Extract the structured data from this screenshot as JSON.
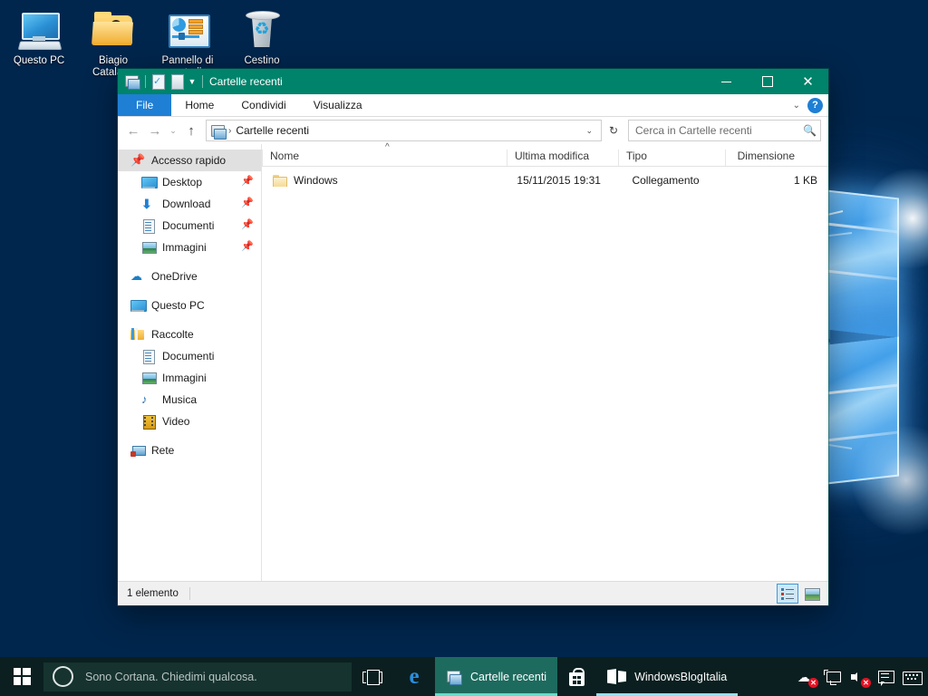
{
  "desktop": {
    "icons": [
      {
        "name": "Questo PC",
        "icon": "computer-icon"
      },
      {
        "name": "Biagio Catalano",
        "icon": "user-folder-icon"
      },
      {
        "name": "Pannello di controllo",
        "icon": "control-panel-icon"
      },
      {
        "name": "Cestino",
        "icon": "recycle-bin-icon"
      }
    ]
  },
  "explorer": {
    "title": "Cartelle recenti",
    "quick_access_toolbar": [
      {
        "icon": "explorer-icon",
        "name": "folder-properties"
      },
      {
        "icon": "properties-icon",
        "name": "properties"
      },
      {
        "icon": "new-folder-icon",
        "name": "new-folder"
      },
      {
        "icon": "chevron-down-icon",
        "name": "customize-qat"
      }
    ],
    "window_controls": {
      "minimize": "minimize-icon",
      "maximize": "maximize-icon",
      "close": "close-icon"
    },
    "ribbon": {
      "tabs": [
        {
          "label": "File",
          "active": true
        },
        {
          "label": "Home",
          "active": false
        },
        {
          "label": "Condividi",
          "active": false
        },
        {
          "label": "Visualizza",
          "active": false
        }
      ],
      "collapse_icon": "chevron-down-icon",
      "help_label": "?"
    },
    "addressbar": {
      "back_icon": "arrow-left-icon",
      "forward_icon": "arrow-right-icon",
      "recent_icon": "chevron-down-icon",
      "up_icon": "arrow-up-icon",
      "crumb": "Cartelle recenti",
      "separator": "›",
      "dropdown_icon": "chevron-down-icon",
      "refresh_icon": "↻"
    },
    "search": {
      "placeholder": "Cerca in Cartelle recenti",
      "icon": "search-icon"
    },
    "navigation_pane": {
      "sections": [
        {
          "header": {
            "label": "Accesso rapido",
            "icon": "star-pin-icon",
            "selected": true
          },
          "items": [
            {
              "label": "Desktop",
              "icon": "desktop-icon",
              "pinned": true
            },
            {
              "label": "Download",
              "icon": "download-icon",
              "pinned": true
            },
            {
              "label": "Documenti",
              "icon": "documents-icon",
              "pinned": true
            },
            {
              "label": "Immagini",
              "icon": "pictures-icon",
              "pinned": true
            }
          ]
        },
        {
          "header": {
            "label": "OneDrive",
            "icon": "onedrive-cloud-icon",
            "selected": false
          },
          "items": []
        },
        {
          "header": {
            "label": "Questo PC",
            "icon": "computer-icon",
            "selected": false
          },
          "items": []
        },
        {
          "header": {
            "label": "Raccolte",
            "icon": "libraries-icon",
            "selected": false
          },
          "items": [
            {
              "label": "Documenti",
              "icon": "documents-icon",
              "pinned": false
            },
            {
              "label": "Immagini",
              "icon": "pictures-icon",
              "pinned": false
            },
            {
              "label": "Musica",
              "icon": "music-icon",
              "pinned": false
            },
            {
              "label": "Video",
              "icon": "video-icon",
              "pinned": false
            }
          ]
        },
        {
          "header": {
            "label": "Rete",
            "icon": "network-icon",
            "selected": false
          },
          "items": []
        }
      ]
    },
    "filelist": {
      "sort_indicator": "^",
      "columns": [
        {
          "key": "name",
          "label": "Nome"
        },
        {
          "key": "modified",
          "label": "Ultima modifica"
        },
        {
          "key": "type",
          "label": "Tipo"
        },
        {
          "key": "size",
          "label": "Dimensione"
        }
      ],
      "rows": [
        {
          "icon": "folder-icon",
          "name": "Windows",
          "modified": "15/11/2015 19:31",
          "type": "Collegamento",
          "size": "1 KB"
        }
      ]
    },
    "statusbar": {
      "count_text": "1 elemento",
      "view_buttons": [
        {
          "name": "details-view-button",
          "icon": "details-view-icon",
          "active": true
        },
        {
          "name": "large-icons-view-button",
          "icon": "large-icons-view-icon",
          "active": false
        }
      ]
    }
  },
  "taskbar": {
    "start": {
      "icon": "windows-logo-icon"
    },
    "cortana": {
      "placeholder": "Sono Cortana. Chiedimi qualcosa.",
      "icon": "cortana-circle-icon"
    },
    "task_view": {
      "icon": "task-view-icon"
    },
    "apps": [
      {
        "label": "",
        "icon": "edge-icon",
        "active": false,
        "pinned": true
      },
      {
        "label": "Cartelle recenti",
        "icon": "explorer-icon",
        "active": true,
        "pinned": false
      },
      {
        "label": "",
        "icon": "store-icon",
        "active": false,
        "pinned": true
      },
      {
        "label": "WindowsBlogItalia",
        "icon": "windows-tile-icon",
        "active": false,
        "pinned": false
      }
    ],
    "tray": [
      {
        "name": "onedrive-tray-icon",
        "badge": "x"
      },
      {
        "name": "network-tray-icon",
        "badge": ""
      },
      {
        "name": "volume-tray-icon",
        "badge": "x"
      },
      {
        "name": "action-center-icon",
        "badge": ""
      },
      {
        "name": "touch-keyboard-icon",
        "badge": ""
      }
    ]
  },
  "colors": {
    "titlebar": "#00836b",
    "accent_blue": "#1f7fd4",
    "taskbar": "#0b1f20",
    "active_task": "#1d6b5e",
    "selection": "#e0e0e0"
  }
}
